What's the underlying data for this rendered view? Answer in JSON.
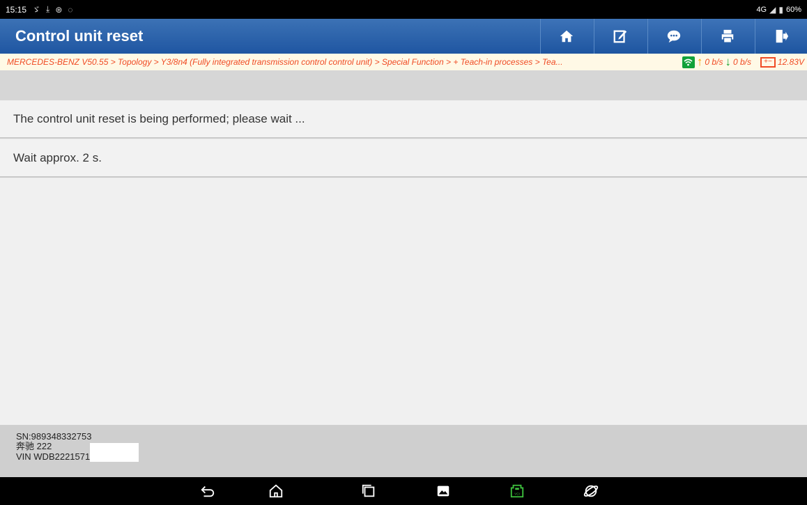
{
  "statusbar": {
    "time": "15:15",
    "left_icons": [
      "usb-debug-icon",
      "download-icon",
      "accessibility-icon",
      "message-icon"
    ],
    "network": "4G",
    "battery": "60%"
  },
  "header": {
    "title": "Control unit reset",
    "tools": [
      "home-icon",
      "edit-icon",
      "chat-icon",
      "print-icon",
      "exit-icon"
    ]
  },
  "breadcrumb": {
    "path": "MERCEDES-BENZ V50.55 > Topology > Y3/8n4 (Fully integrated transmission control control unit) > Special Function > + Teach-in processes > Tea...",
    "upload": "0 b/s",
    "download": "0 b/s",
    "voltage": "12.83V"
  },
  "messages": [
    "The control unit reset is being performed; please wait ...",
    "Wait approx. 2 s."
  ],
  "footer": {
    "sn": "SN:989348332753",
    "model": "奔驰 222",
    "vin": "VIN WDB2221571"
  },
  "navbar": {
    "buttons": [
      "back-icon",
      "home-icon",
      "recents-icon",
      "screenshot-icon",
      "vci-icon",
      "browser-icon"
    ],
    "vci_color": "#3ec23e"
  },
  "colors": {
    "header": "#2a60a8",
    "breadcrumb_text": "#f04a23",
    "breadcrumb_bg": "#fff9e6"
  }
}
